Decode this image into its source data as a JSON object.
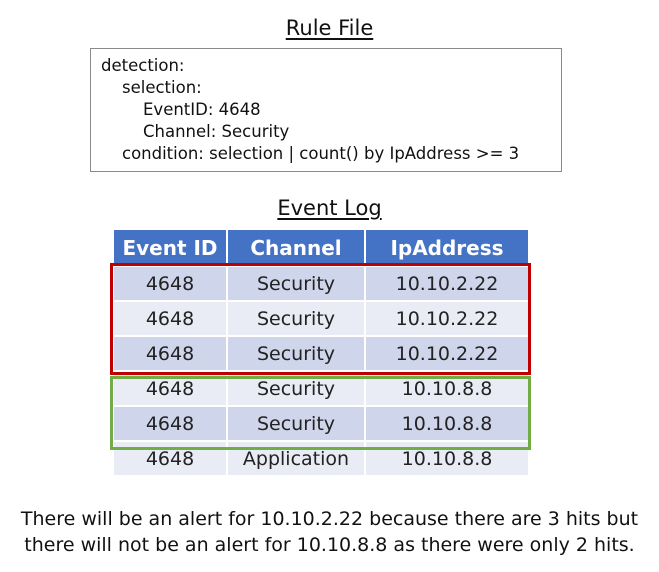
{
  "rule_file": {
    "title": "Rule File",
    "lines": [
      "detection:",
      "selection:",
      "EventID: 4648",
      "Channel: Security",
      "condition: selection | count() by IpAddress >= 3"
    ]
  },
  "event_log": {
    "title": "Event Log",
    "columns": [
      "Event ID",
      "Channel",
      "IpAddress"
    ],
    "rows": [
      [
        "4648",
        "Security",
        "10.10.2.22"
      ],
      [
        "4648",
        "Security",
        "10.10.2.22"
      ],
      [
        "4648",
        "Security",
        "10.10.2.22"
      ],
      [
        "4648",
        "Security",
        "10.10.8.8"
      ],
      [
        "4648",
        "Security",
        "10.10.8.8"
      ],
      [
        "4648",
        "Application",
        "10.10.8.8"
      ]
    ],
    "highlight_colors": {
      "alert_group": "#c00000",
      "no_alert_group": "#70ad47"
    },
    "header_color": "#4472c4"
  },
  "caption": {
    "line1": "There will be an alert for 10.10.2.22 because there are 3 hits but",
    "line2": "there will not be an alert for 10.10.8.8 as there were only 2 hits."
  }
}
